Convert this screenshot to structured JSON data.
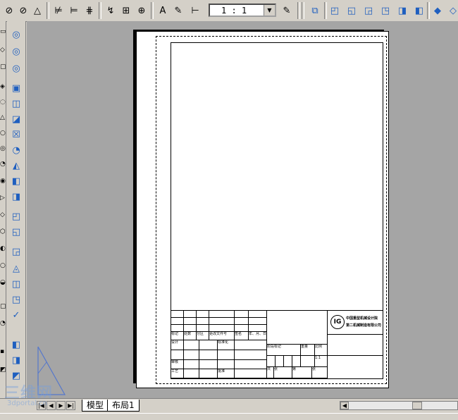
{
  "toolbar": {
    "scale_value": "1 : 1",
    "icons": [
      "circle-slash-icon",
      "circle-slash-icon",
      "triangle-icon",
      "dim-align-icon",
      "dim-icon",
      "dim-grid-icon",
      "leader-icon",
      "zoom-box-icon",
      "target-icon",
      "text-a-icon",
      "text-edit-icon",
      "dim-style-icon",
      "scale-edit-icon",
      "view-icon",
      "cube-top-icon",
      "cube-front-icon",
      "cube-left-icon",
      "cube-right-icon",
      "cube-back-icon",
      "cube-iso-icon",
      "cube-iso2-icon"
    ]
  },
  "tabs": {
    "model": "模型",
    "layout1": "布局1"
  },
  "titleblock": {
    "company_line1": "中国重型机械设计院",
    "company_line2": "第二机械制造有限公司",
    "row_labels": [
      "标记",
      "处数",
      "分区",
      "更改文件号",
      "签名",
      "年、月、日"
    ],
    "designer": "设计",
    "standardization": "标准化",
    "review": "审核",
    "process": "工艺",
    "approve": "批准",
    "stage_mark": "阶段标记",
    "weight": "重量",
    "scale": "比例",
    "scale_value": "1:1",
    "total": "共",
    "sheet": "张",
    "no": "第",
    "page": "张"
  },
  "watermark": {
    "main": "三维网",
    "sub": "3dportal.cn"
  }
}
